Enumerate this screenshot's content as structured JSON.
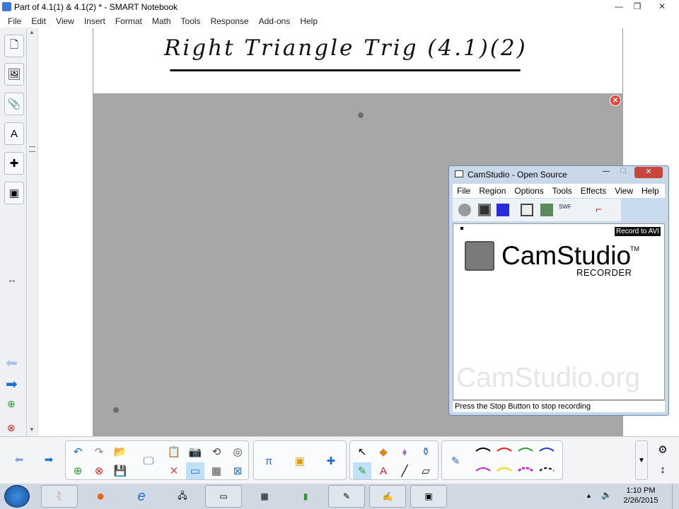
{
  "window": {
    "title": "Part of 4.1(1) & 4.1(2) * - SMART Notebook"
  },
  "menu": [
    "File",
    "Edit",
    "View",
    "Insert",
    "Format",
    "Math",
    "Tools",
    "Response",
    "Add-ons",
    "Help"
  ],
  "page": {
    "title": "Right Triangle Trig (4.1)(2)"
  },
  "camstudio": {
    "title": "CamStudio - Open Source",
    "menu": [
      "File",
      "Region",
      "Options",
      "Tools",
      "Effects",
      "View",
      "Help"
    ],
    "tooltip": "Record to AVI",
    "logo_text": "CamStudio",
    "logo_tm": "TM",
    "logo_sub": "RECORDER",
    "watermark": "CamStudio.org",
    "status": "Press the Stop Button to stop recording"
  },
  "taskbar": {
    "time": "1:10 PM",
    "date": "2/26/2015"
  },
  "colors": {
    "pen_black": "#000000",
    "pen_red": "#e02020",
    "pen_green": "#2aa02a",
    "pen_blue": "#2038c8",
    "pen_magenta": "#d020d0",
    "pen_yellow": "#e8d800"
  }
}
